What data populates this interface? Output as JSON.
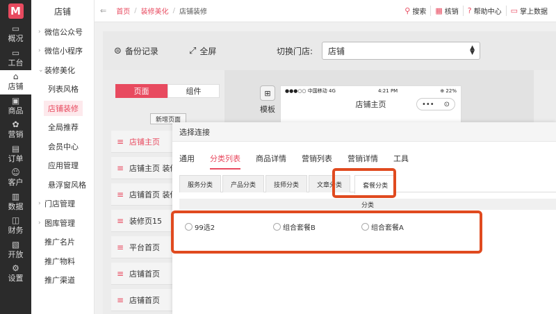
{
  "rail": {
    "logo": "M",
    "items": [
      {
        "icon": "monitor-icon",
        "glyph": "▭",
        "label": "概况"
      },
      {
        "icon": "desk-icon",
        "glyph": "▭",
        "label": "工台"
      },
      {
        "icon": "store-icon",
        "glyph": "⌂",
        "label": "店铺"
      },
      {
        "icon": "bag-icon",
        "glyph": "▣",
        "label": "商品"
      },
      {
        "icon": "marketing-icon",
        "glyph": "✿",
        "label": "营销"
      },
      {
        "icon": "order-icon",
        "glyph": "▤",
        "label": "订单"
      },
      {
        "icon": "customer-icon",
        "glyph": "☺",
        "label": "客户"
      },
      {
        "icon": "data-icon",
        "glyph": "▥",
        "label": "数据"
      },
      {
        "icon": "finance-icon",
        "glyph": "◫",
        "label": "财务"
      },
      {
        "icon": "open-icon",
        "glyph": "▧",
        "label": "开放"
      },
      {
        "icon": "settings-icon",
        "glyph": "⚙",
        "label": "设置"
      }
    ]
  },
  "submenu": {
    "title": "店铺",
    "items": [
      {
        "label": "微信公众号",
        "arrow": "›"
      },
      {
        "label": "微信小程序",
        "arrow": "›"
      },
      {
        "label": "装修美化",
        "arrow": "⌄"
      },
      {
        "label": "列表风格",
        "child": true
      },
      {
        "label": "店铺装修",
        "child": true
      },
      {
        "label": "全局推荐",
        "child": true
      },
      {
        "label": "会员中心",
        "child": true
      },
      {
        "label": "应用管理",
        "child": true
      },
      {
        "label": "悬浮窗风格",
        "child": true
      },
      {
        "label": "门店管理",
        "arrow": "›"
      },
      {
        "label": "图库管理",
        "arrow": "›"
      },
      {
        "label": "推广名片"
      },
      {
        "label": "推广物料"
      },
      {
        "label": "推广渠道"
      }
    ]
  },
  "topbar": {
    "back": "⇐",
    "crumbs": [
      "首页",
      "装修美化",
      "店铺装修"
    ],
    "sep": "/",
    "actions": [
      {
        "icon": "search-icon",
        "glyph": "⚲",
        "label": "搜索"
      },
      {
        "icon": "verify-icon",
        "glyph": "▦",
        "label": "核销"
      },
      {
        "icon": "help-icon",
        "glyph": "?",
        "label": "帮助中心"
      },
      {
        "icon": "mobile-data-icon",
        "glyph": "▭",
        "label": "掌上数据"
      }
    ]
  },
  "toolbar": {
    "backup": "备份记录",
    "backup_glyph": "⊜",
    "fullscreen": "全屏",
    "fullscreen_glyph": "⤢",
    "switch_label": "切换门店:",
    "store_value": "店铺"
  },
  "left": {
    "seg_pages": "页面",
    "seg_components": "组件",
    "new_page": "新增页面",
    "pages": [
      "店铺主页",
      "店铺主页 装修",
      "店铺首页 装修",
      "装修页15",
      "平台首页",
      "店铺首页",
      "店铺首页"
    ]
  },
  "modules": {
    "label": "模板",
    "glyph": "⊞"
  },
  "phone": {
    "carrier": "●●●○○ 中国移动 4G",
    "time": "4:21 PM",
    "battery": "⊕ 22%",
    "title": "店铺主页",
    "pill_more": "•••",
    "pill_target": "⊙"
  },
  "modal": {
    "title": "选择连接",
    "tabs": [
      "通用",
      "分类列表",
      "商品详情",
      "营销列表",
      "营销详情",
      "工具"
    ],
    "active_tab": 1,
    "subtabs": [
      "服务分类",
      "产品分类",
      "技师分类",
      "文章分类",
      "套餐分类"
    ],
    "active_subtab": 4,
    "category_header": "分类",
    "options": [
      "99选2",
      "组合套餐B",
      "组合套餐A"
    ]
  }
}
